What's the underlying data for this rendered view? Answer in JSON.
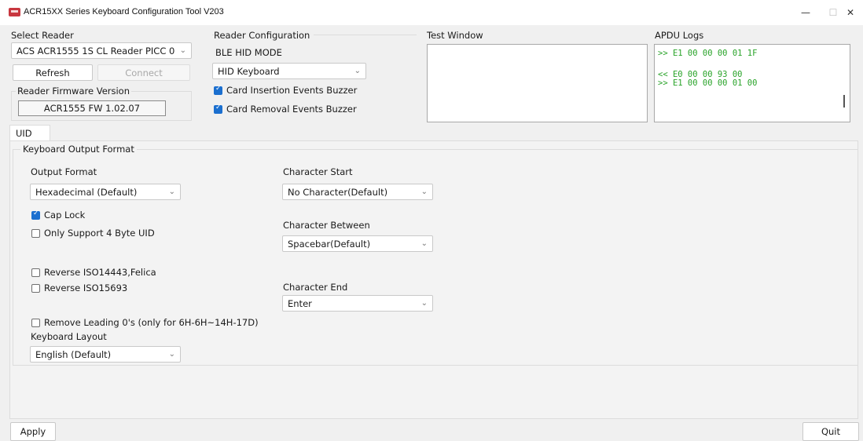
{
  "window": {
    "title": "ACR15XX Series Keyboard Configuration Tool V203",
    "min_glyph": "—",
    "max_glyph": "☐",
    "close_glyph": "✕"
  },
  "select_reader": {
    "title": "Select Reader",
    "value": "ACS ACR1555 1S CL Reader PICC 0",
    "refresh_label": "Refresh",
    "connect_label": "Connect"
  },
  "firmware": {
    "title": "Reader Firmware Version",
    "value": "ACR1555 FW 1.02.07"
  },
  "reader_config": {
    "title": "Reader Configuration",
    "mode_label": "BLE HID MODE",
    "mode_value": "HID Keyboard",
    "insert_buzzer_label": "Card Insertion Events Buzzer",
    "insert_buzzer_checked": true,
    "removal_buzzer_label": "Card Removal Events Buzzer",
    "removal_buzzer_checked": true
  },
  "test_window": {
    "title": "Test Window"
  },
  "apdu_logs": {
    "title": "APDU Logs",
    "lines": [
      ">> E1 00 00 00 01 1F",
      "",
      "<< E0 00 00 93 00",
      ">> E1 00 00 00 01 00"
    ]
  },
  "tabs": {
    "uid": "UID"
  },
  "kof": {
    "title": "Keyboard Output Format",
    "output_format_label": "Output Format",
    "output_format_value": "Hexadecimal (Default)",
    "cap_lock_label": "Cap Lock",
    "cap_lock_checked": true,
    "only4_label": "Only Support 4 Byte UID",
    "only4_checked": false,
    "reverse_iso14443_label": "Reverse ISO14443,Felica",
    "reverse_iso14443_checked": false,
    "reverse_iso15693_label": "Reverse ISO15693",
    "reverse_iso15693_checked": false,
    "remove_leading_label": "Remove Leading 0's (only for 6H-6H~14H-17D)",
    "remove_leading_checked": false,
    "keyboard_layout_label": "Keyboard Layout",
    "keyboard_layout_value": "English (Default)",
    "char_start_label": "Character Start",
    "char_start_value": "No Character(Default)",
    "char_between_label": "Character Between",
    "char_between_value": "Spacebar(Default)",
    "char_end_label": "Character End",
    "char_end_value": "Enter"
  },
  "footer": {
    "apply_label": "Apply",
    "quit_label": "Quit"
  },
  "colors": {
    "accent": "#1b6fcf",
    "log_text": "#29a329",
    "app_icon": "#c8373f"
  }
}
